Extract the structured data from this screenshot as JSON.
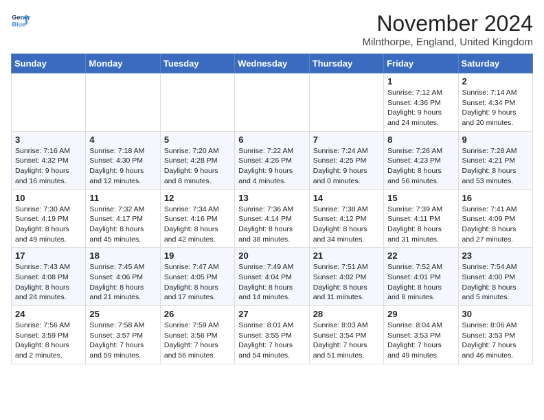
{
  "header": {
    "logo_line1": "General",
    "logo_line2": "Blue",
    "month_title": "November 2024",
    "location": "Milnthorpe, England, United Kingdom"
  },
  "days_of_week": [
    "Sunday",
    "Monday",
    "Tuesday",
    "Wednesday",
    "Thursday",
    "Friday",
    "Saturday"
  ],
  "weeks": [
    [
      {
        "day": "",
        "detail": ""
      },
      {
        "day": "",
        "detail": ""
      },
      {
        "day": "",
        "detail": ""
      },
      {
        "day": "",
        "detail": ""
      },
      {
        "day": "",
        "detail": ""
      },
      {
        "day": "1",
        "detail": "Sunrise: 7:12 AM\nSunset: 4:36 PM\nDaylight: 9 hours and 24 minutes."
      },
      {
        "day": "2",
        "detail": "Sunrise: 7:14 AM\nSunset: 4:34 PM\nDaylight: 9 hours and 20 minutes."
      }
    ],
    [
      {
        "day": "3",
        "detail": "Sunrise: 7:16 AM\nSunset: 4:32 PM\nDaylight: 9 hours and 16 minutes."
      },
      {
        "day": "4",
        "detail": "Sunrise: 7:18 AM\nSunset: 4:30 PM\nDaylight: 9 hours and 12 minutes."
      },
      {
        "day": "5",
        "detail": "Sunrise: 7:20 AM\nSunset: 4:28 PM\nDaylight: 9 hours and 8 minutes."
      },
      {
        "day": "6",
        "detail": "Sunrise: 7:22 AM\nSunset: 4:26 PM\nDaylight: 9 hours and 4 minutes."
      },
      {
        "day": "7",
        "detail": "Sunrise: 7:24 AM\nSunset: 4:25 PM\nDaylight: 9 hours and 0 minutes."
      },
      {
        "day": "8",
        "detail": "Sunrise: 7:26 AM\nSunset: 4:23 PM\nDaylight: 8 hours and 56 minutes."
      },
      {
        "day": "9",
        "detail": "Sunrise: 7:28 AM\nSunset: 4:21 PM\nDaylight: 8 hours and 53 minutes."
      }
    ],
    [
      {
        "day": "10",
        "detail": "Sunrise: 7:30 AM\nSunset: 4:19 PM\nDaylight: 8 hours and 49 minutes."
      },
      {
        "day": "11",
        "detail": "Sunrise: 7:32 AM\nSunset: 4:17 PM\nDaylight: 8 hours and 45 minutes."
      },
      {
        "day": "12",
        "detail": "Sunrise: 7:34 AM\nSunset: 4:16 PM\nDaylight: 8 hours and 42 minutes."
      },
      {
        "day": "13",
        "detail": "Sunrise: 7:36 AM\nSunset: 4:14 PM\nDaylight: 8 hours and 38 minutes."
      },
      {
        "day": "14",
        "detail": "Sunrise: 7:38 AM\nSunset: 4:12 PM\nDaylight: 8 hours and 34 minutes."
      },
      {
        "day": "15",
        "detail": "Sunrise: 7:39 AM\nSunset: 4:11 PM\nDaylight: 8 hours and 31 minutes."
      },
      {
        "day": "16",
        "detail": "Sunrise: 7:41 AM\nSunset: 4:09 PM\nDaylight: 8 hours and 27 minutes."
      }
    ],
    [
      {
        "day": "17",
        "detail": "Sunrise: 7:43 AM\nSunset: 4:08 PM\nDaylight: 8 hours and 24 minutes."
      },
      {
        "day": "18",
        "detail": "Sunrise: 7:45 AM\nSunset: 4:06 PM\nDaylight: 8 hours and 21 minutes."
      },
      {
        "day": "19",
        "detail": "Sunrise: 7:47 AM\nSunset: 4:05 PM\nDaylight: 8 hours and 17 minutes."
      },
      {
        "day": "20",
        "detail": "Sunrise: 7:49 AM\nSunset: 4:04 PM\nDaylight: 8 hours and 14 minutes."
      },
      {
        "day": "21",
        "detail": "Sunrise: 7:51 AM\nSunset: 4:02 PM\nDaylight: 8 hours and 11 minutes."
      },
      {
        "day": "22",
        "detail": "Sunrise: 7:52 AM\nSunset: 4:01 PM\nDaylight: 8 hours and 8 minutes."
      },
      {
        "day": "23",
        "detail": "Sunrise: 7:54 AM\nSunset: 4:00 PM\nDaylight: 8 hours and 5 minutes."
      }
    ],
    [
      {
        "day": "24",
        "detail": "Sunrise: 7:56 AM\nSunset: 3:59 PM\nDaylight: 8 hours and 2 minutes."
      },
      {
        "day": "25",
        "detail": "Sunrise: 7:58 AM\nSunset: 3:57 PM\nDaylight: 7 hours and 59 minutes."
      },
      {
        "day": "26",
        "detail": "Sunrise: 7:59 AM\nSunset: 3:56 PM\nDaylight: 7 hours and 56 minutes."
      },
      {
        "day": "27",
        "detail": "Sunrise: 8:01 AM\nSunset: 3:55 PM\nDaylight: 7 hours and 54 minutes."
      },
      {
        "day": "28",
        "detail": "Sunrise: 8:03 AM\nSunset: 3:54 PM\nDaylight: 7 hours and 51 minutes."
      },
      {
        "day": "29",
        "detail": "Sunrise: 8:04 AM\nSunset: 3:53 PM\nDaylight: 7 hours and 49 minutes."
      },
      {
        "day": "30",
        "detail": "Sunrise: 8:06 AM\nSunset: 3:53 PM\nDaylight: 7 hours and 46 minutes."
      }
    ]
  ]
}
